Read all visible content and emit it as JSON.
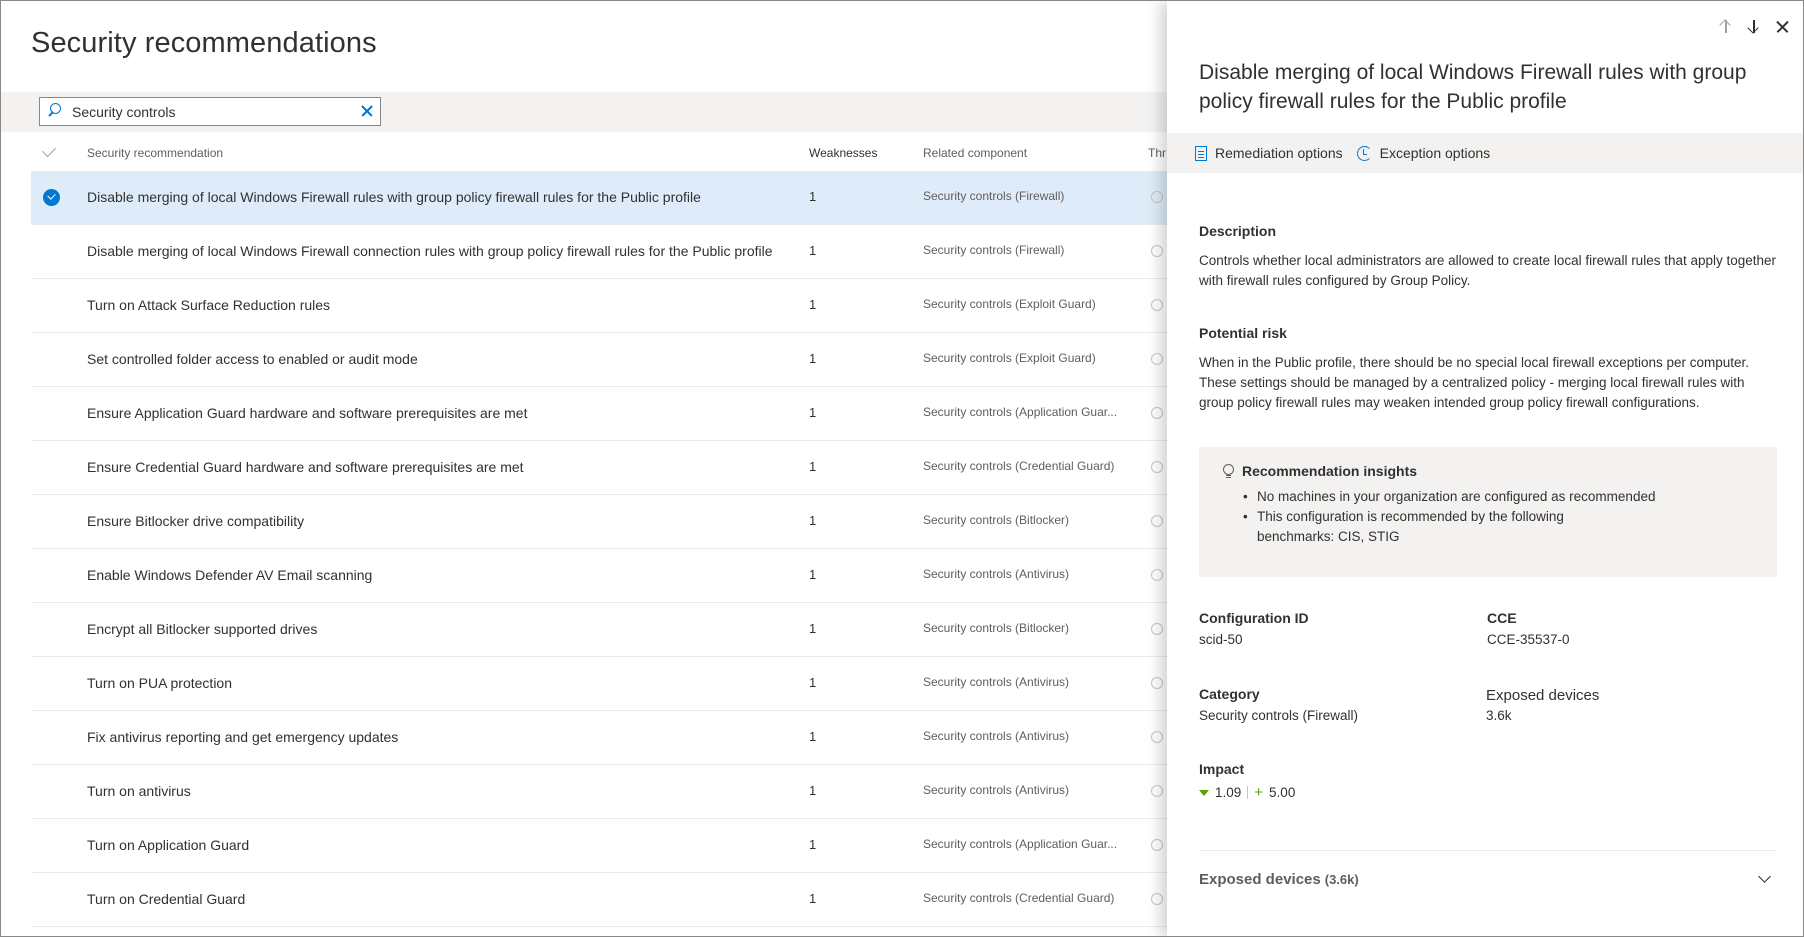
{
  "page": {
    "title": "Security recommendations"
  },
  "search": {
    "value": "Security controls"
  },
  "table": {
    "headers": {
      "recommendation": "Security recommendation",
      "weaknesses": "Weaknesses",
      "component": "Related component",
      "threats": "Thr"
    },
    "rows": [
      {
        "name": "Disable merging of local Windows Firewall rules with group policy firewall rules for the Public profile",
        "weaknesses": "1",
        "component": "Security controls (Firewall)",
        "selected": true
      },
      {
        "name": "Disable merging of local Windows Firewall connection rules with group policy firewall rules for the Public profile",
        "weaknesses": "1",
        "component": "Security controls (Firewall)"
      },
      {
        "name": "Turn on Attack Surface Reduction rules",
        "weaknesses": "1",
        "component": "Security controls (Exploit Guard)"
      },
      {
        "name": "Set controlled folder access to enabled or audit mode",
        "weaknesses": "1",
        "component": "Security controls (Exploit Guard)"
      },
      {
        "name": "Ensure Application Guard hardware and software prerequisites are met",
        "weaknesses": "1",
        "component": "Security controls (Application Guar..."
      },
      {
        "name": "Ensure Credential Guard hardware and software prerequisites are met",
        "weaknesses": "1",
        "component": "Security controls (Credential Guard)"
      },
      {
        "name": "Ensure Bitlocker drive compatibility",
        "weaknesses": "1",
        "component": "Security controls (Bitlocker)"
      },
      {
        "name": "Enable Windows Defender AV Email scanning",
        "weaknesses": "1",
        "component": "Security controls (Antivirus)"
      },
      {
        "name": "Encrypt all Bitlocker supported drives",
        "weaknesses": "1",
        "component": "Security controls (Bitlocker)"
      },
      {
        "name": "Turn on PUA protection",
        "weaknesses": "1",
        "component": "Security controls (Antivirus)"
      },
      {
        "name": "Fix antivirus reporting and get emergency updates",
        "weaknesses": "1",
        "component": "Security controls (Antivirus)"
      },
      {
        "name": "Turn on antivirus",
        "weaknesses": "1",
        "component": "Security controls (Antivirus)"
      },
      {
        "name": "Turn on Application Guard",
        "weaknesses": "1",
        "component": "Security controls (Application Guar..."
      },
      {
        "name": "Turn on Credential Guard",
        "weaknesses": "1",
        "component": "Security controls (Credential Guard)"
      }
    ]
  },
  "panel": {
    "title": "Disable merging of local Windows Firewall rules with group policy firewall rules for the Public profile",
    "commands": {
      "remediation": "Remediation options",
      "exception": "Exception options"
    },
    "description": {
      "heading": "Description",
      "text": "Controls whether local administrators are allowed to create local firewall rules that apply together with firewall rules configured by Group Policy."
    },
    "risk": {
      "heading": "Potential risk",
      "text": "When in the Public profile, there should be no special local firewall exceptions per computer. These settings should be managed by a centralized policy - merging local firewall rules with group policy firewall rules may weaken intended group policy firewall configurations."
    },
    "insights": {
      "heading": "Recommendation insights",
      "items": [
        "No machines in your organization are configured as recommended",
        "This configuration is recommended by the following benchmarks: CIS, STIG"
      ]
    },
    "config_id": {
      "label": "Configuration ID",
      "value": "scid-50"
    },
    "cce": {
      "label": "CCE",
      "value": "CCE-35537-0"
    },
    "category": {
      "label": "Category",
      "value": "Security controls (Firewall)"
    },
    "exposed": {
      "label": "Exposed devices",
      "value": "3.6k"
    },
    "impact": {
      "label": "Impact",
      "exposure": "1.09",
      "score": "5.00"
    },
    "exposed_section": {
      "label": "Exposed devices",
      "count": "(3.6k)"
    }
  },
  "colors": {
    "accent": "#0078d4",
    "selected_row": "#deecf9",
    "impact_green": "#57a300"
  }
}
